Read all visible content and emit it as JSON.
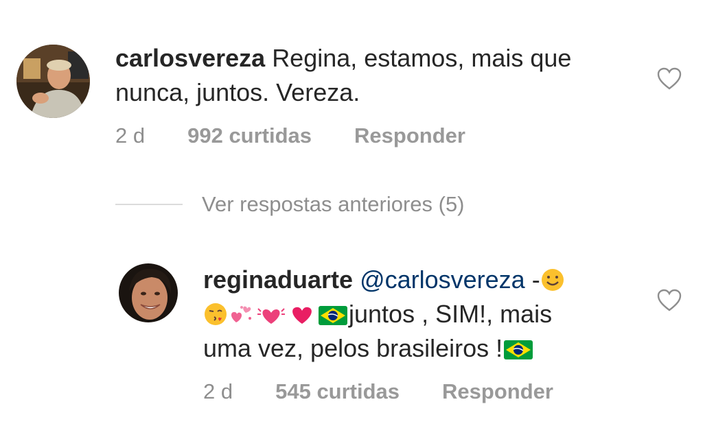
{
  "comments": [
    {
      "username": "carlosvereza",
      "text_line1": "Regina, estamos, mais que",
      "text_line2": "nunca, juntos. Vereza.",
      "time": "2 d",
      "likes": "992 curtidas",
      "reply_label": "Responder",
      "avatar_icon": "avatar-photo"
    },
    {
      "username": "reginaduarte",
      "mention": "@carlosvereza",
      "dash": "-",
      "text_line2": "juntos , SIM!, mais",
      "text_line3": "uma vez, pelos brasileiros !",
      "time": "2 d",
      "likes": "545 curtidas",
      "reply_label": "Responder",
      "avatar_icon": "avatar-photo"
    }
  ],
  "view_previous": "Ver respostas anteriores (5)",
  "colors": {
    "text": "#262626",
    "muted": "#8e8e8e",
    "mention": "#003569",
    "divider": "#dbdbdb"
  },
  "icons": [
    "heart-outline-icon",
    "smile-emoji",
    "kiss-emoji",
    "sparkling-hearts-emoji",
    "beating-heart-emoji",
    "red-heart-emoji",
    "brazil-flag-emoji"
  ]
}
